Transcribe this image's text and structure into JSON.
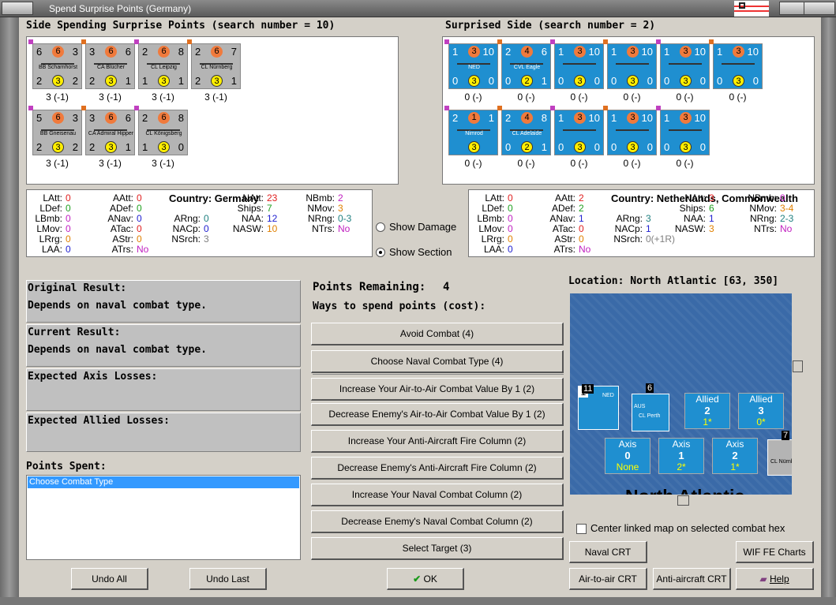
{
  "window": {
    "title": "Spend Surprise Points (Germany)"
  },
  "spending": {
    "header": "Side Spending Surprise Points (search number = 10)",
    "units": [
      {
        "att": "6",
        "mid": "6",
        "def": "3",
        "name": "BB Scharnhorst",
        "l": "2",
        "y": "3",
        "r": "2",
        "cost": "3 (-1)"
      },
      {
        "att": "3",
        "mid": "6",
        "def": "6",
        "name": "CA Blücher",
        "l": "2",
        "y": "3",
        "r": "1",
        "cost": "3 (-1)"
      },
      {
        "att": "2",
        "mid": "6",
        "def": "8",
        "name": "CL Leipzig",
        "l": "1",
        "y": "3",
        "r": "1",
        "cost": "3 (-1)"
      },
      {
        "att": "2",
        "mid": "6",
        "def": "7",
        "name": "CL Nürnberg",
        "l": "2",
        "y": "3",
        "r": "1",
        "cost": "3 (-1)"
      },
      {
        "att": "5",
        "mid": "6",
        "def": "3",
        "name": "BB Gneisenau",
        "l": "2",
        "y": "3",
        "r": "2",
        "cost": "3 (-1)"
      },
      {
        "att": "3",
        "mid": "6",
        "def": "6",
        "name": "CA Admiral Hipper",
        "l": "2",
        "y": "3",
        "r": "1",
        "cost": "3 (-1)"
      },
      {
        "att": "2",
        "mid": "6",
        "def": "8",
        "name": "CL Königsberg",
        "l": "1",
        "y": "3",
        "r": "0",
        "cost": "3 (-1)"
      }
    ]
  },
  "surprised": {
    "header": "Surprised Side (search number = 2)",
    "units": [
      {
        "att": "1",
        "mid": "3",
        "def": "10",
        "name": "NED",
        "l": "0",
        "y": "3",
        "r": "0",
        "cost": "0 (-)"
      },
      {
        "att": "2",
        "mid": "4",
        "def": "6",
        "name": "CVL Eagle",
        "l": "0",
        "y": "2",
        "r": "1",
        "cost": "0 (-)"
      },
      {
        "att": "1",
        "mid": "3",
        "def": "10",
        "name": "",
        "l": "0",
        "y": "3",
        "r": "0",
        "cost": "0 (-)"
      },
      {
        "att": "1",
        "mid": "3",
        "def": "10",
        "name": "",
        "l": "0",
        "y": "3",
        "r": "0",
        "cost": "0 (-)"
      },
      {
        "att": "1",
        "mid": "3",
        "def": "10",
        "name": "",
        "l": "0",
        "y": "3",
        "r": "0",
        "cost": "0 (-)"
      },
      {
        "att": "1",
        "mid": "3",
        "def": "10",
        "name": "",
        "l": "0",
        "y": "3",
        "r": "0",
        "cost": "0 (-)"
      },
      {
        "att": "2",
        "mid": "1",
        "def": "1",
        "name": "Nimrod",
        "l": "",
        "y": "3",
        "r": "",
        "cost": "0 (-)"
      },
      {
        "att": "2",
        "mid": "4",
        "def": "8",
        "name": "CL Adelaide",
        "l": "0",
        "y": "2",
        "r": "1",
        "cost": "0 (-)"
      },
      {
        "att": "1",
        "mid": "3",
        "def": "10",
        "name": "",
        "l": "0",
        "y": "3",
        "r": "0",
        "cost": "0 (-)"
      },
      {
        "att": "1",
        "mid": "3",
        "def": "10",
        "name": "",
        "l": "0",
        "y": "3",
        "r": "0",
        "cost": "0 (-)"
      },
      {
        "att": "1",
        "mid": "3",
        "def": "10",
        "name": "",
        "l": "0",
        "y": "3",
        "r": "0",
        "cost": "0 (-)"
      }
    ]
  },
  "stats_left": {
    "country_label": "Country: Germany",
    "items": [
      [
        "LAtt:",
        "0"
      ],
      [
        "LDef:",
        "0"
      ],
      [
        "LBmb:",
        "0"
      ],
      [
        "LMov:",
        "0"
      ],
      [
        "LRrg:",
        "0"
      ],
      [
        "LAA:",
        "0"
      ],
      [
        "AAtt:",
        "0"
      ],
      [
        "ADef:",
        "0"
      ],
      [
        "ANav:",
        "0"
      ],
      [
        "ATac:",
        "0"
      ],
      [
        "AStr:",
        "0"
      ],
      [
        "ATrs:",
        "No"
      ],
      [
        "ARng:",
        "0"
      ],
      [
        "NACp:",
        "0"
      ],
      [
        "NSrch:",
        "3"
      ],
      [
        "NAtt:",
        "23"
      ],
      [
        "Ships:",
        "7"
      ],
      [
        "NAA:",
        "12"
      ],
      [
        "NASW:",
        "10"
      ],
      [
        "NBmb:",
        "2"
      ],
      [
        "NMov:",
        "3"
      ],
      [
        "NRng:",
        "0-3"
      ],
      [
        "NTrs:",
        "No"
      ]
    ]
  },
  "stats_right": {
    "country_label": "Country: Netherlands, Commonwealth",
    "items": [
      [
        "LAtt:",
        "0"
      ],
      [
        "LDef:",
        "0"
      ],
      [
        "LBmb:",
        "0"
      ],
      [
        "LMov:",
        "0"
      ],
      [
        "LRrg:",
        "0"
      ],
      [
        "LAA:",
        "0"
      ],
      [
        "AAtt:",
        "2"
      ],
      [
        "ADef:",
        "2"
      ],
      [
        "ANav:",
        "1"
      ],
      [
        "ATac:",
        "0"
      ],
      [
        "AStr:",
        "0"
      ],
      [
        "ATrs:",
        "No"
      ],
      [
        "ARng:",
        "3"
      ],
      [
        "NACp:",
        "1"
      ],
      [
        "NSrch:",
        "0(+1R)"
      ],
      [
        "NAtt:",
        "3"
      ],
      [
        "Ships:",
        "6"
      ],
      [
        "NAA:",
        "1"
      ],
      [
        "NASW:",
        "3"
      ],
      [
        "NBmb:",
        "0"
      ],
      [
        "NMov:",
        "3-4"
      ],
      [
        "NRng:",
        "2-3"
      ],
      [
        "NTrs:",
        "No"
      ]
    ]
  },
  "options": {
    "show_damage": "Show Damage",
    "show_section": "Show Section"
  },
  "results": {
    "original_label": "Original Result:",
    "original_value": "Depends on naval combat type.",
    "current_label": "Current Result:",
    "current_value": "Depends on naval combat type.",
    "axis_losses_label": "Expected Axis Losses:",
    "allied_losses_label": "Expected Allied Losses:",
    "points_spent_label": "Points Spent:",
    "points_spent_items": [
      "Choose Combat Type"
    ]
  },
  "spend": {
    "remaining_label": "Points Remaining:",
    "remaining_value": "4",
    "ways_label": "Ways to spend points (cost):",
    "buttons": [
      "Avoid Combat (4)",
      "Choose Naval Combat Type (4)",
      "Increase Your Air-to-Air Combat Value By 1 (2)",
      "Decrease Enemy's Air-to-Air Combat Value By 1 (2)",
      "Increase Your Anti-Aircraft Fire Column (2)",
      "Decrease Enemy's Anti-Aircraft Fire Column (2)",
      "Increase Your Naval Combat Column (2)",
      "Decrease Enemy's Naval Combat Column (2)",
      "Select Target (3)"
    ]
  },
  "map": {
    "location": "Location: North Atlantic [63, 350]",
    "sea_label": "North Atlantic",
    "allied_boxes": [
      {
        "title": "Allied",
        "value": "2",
        "sub": "1*"
      },
      {
        "title": "Allied",
        "value": "3",
        "sub": "0*"
      }
    ],
    "axis_boxes": [
      {
        "title": "Axis",
        "value": "0",
        "sub": "None"
      },
      {
        "title": "Axis",
        "value": "1",
        "sub": "2*"
      },
      {
        "title": "Axis",
        "value": "2",
        "sub": "1*"
      }
    ],
    "stack_counts": [
      "11",
      "6",
      "7"
    ],
    "counter_names": [
      "NED",
      "AUS",
      "CL Perth",
      "CL Nürnberg"
    ],
    "center_label": "Center linked map on selected combat hex"
  },
  "bottom": {
    "undo_all": "Undo All",
    "undo_last": "Undo Last",
    "ok": "OK",
    "naval_crt": "Naval CRT",
    "wif_charts": "WIF FE Charts",
    "air_crt": "Air-to-air CRT",
    "aa_crt": "Anti-aircraft CRT",
    "help": "Help"
  },
  "colors": {
    "red": "#e02020",
    "green": "#20a020",
    "magenta": "#c020c0",
    "blue": "#2020d0",
    "orange": "#e08000",
    "teal": "#208080",
    "grey": "#808080",
    "selection": "#3399ff"
  }
}
